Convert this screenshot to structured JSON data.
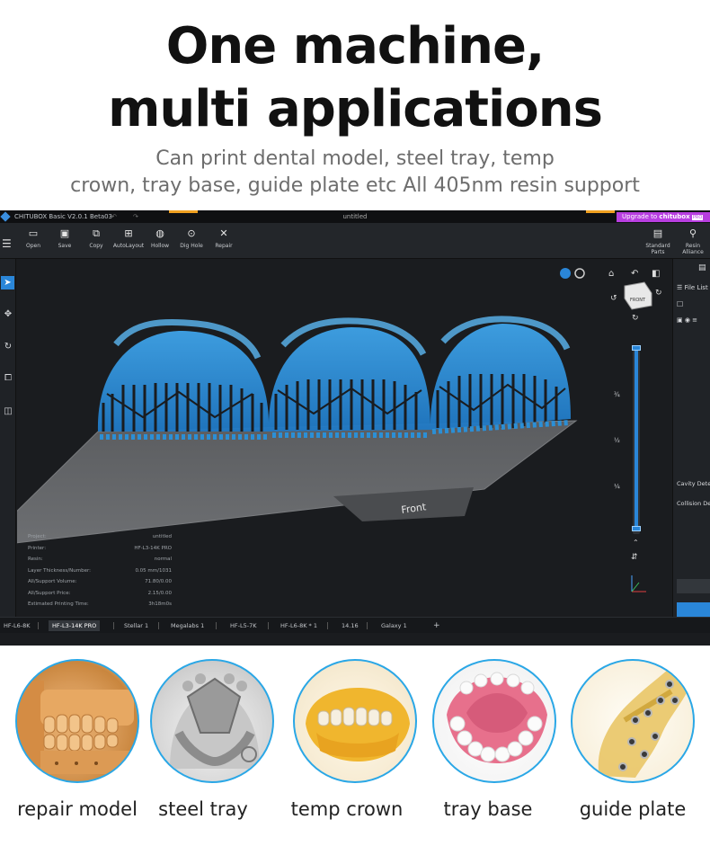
{
  "headline": {
    "line1": "One machine,",
    "line2": "multi applications"
  },
  "subheadline": {
    "line1": "Can print dental model, steel tray, temp",
    "line2": "crown, tray base, guide plate etc All 405nm resin support"
  },
  "app": {
    "title": "CHITUBOX Basic V2.0.1 Beta03",
    "document": "untitled",
    "upgrade_label": "Upgrade to",
    "upgrade_brand": "chitubox",
    "upgrade_tier": "PRO",
    "toolbar": [
      {
        "label": "Open",
        "icon": "folder-icon"
      },
      {
        "label": "Save",
        "icon": "save-icon"
      },
      {
        "label": "Copy",
        "icon": "copy-icon"
      },
      {
        "label": "AutoLayout",
        "icon": "autolayout-icon"
      },
      {
        "label": "Hollow",
        "icon": "hollow-icon"
      },
      {
        "label": "Dig Hole",
        "icon": "dig-hole-icon"
      },
      {
        "label": "Repair",
        "icon": "repair-icon"
      }
    ],
    "toolbar_right": [
      {
        "label": "Standard Parts",
        "icon": "standard-parts-icon"
      },
      {
        "label": "Resin Alliance",
        "icon": "resin-alliance-icon"
      }
    ],
    "right_panel": {
      "file_list": "File List",
      "cavity": "Cavity Detec",
      "collision": "Collision De"
    },
    "view_cube_label": "FRONT",
    "plate_label": "Front",
    "slider_fractions": [
      "¾",
      "½",
      "¼"
    ],
    "info": [
      {
        "key": "Project:",
        "value": "untitled"
      },
      {
        "key": "Printer:",
        "value": "HF-L3-14K PRO"
      },
      {
        "key": "Resin:",
        "value": "normal"
      },
      {
        "key": "Layer Thickness/Number:",
        "value": "0.05 mm/1031"
      },
      {
        "key": "All/Support Volume:",
        "value": "71.80/0.00"
      },
      {
        "key": "All/Support Price:",
        "value": "2.15/0.00"
      },
      {
        "key": "Estimated Printing Time:",
        "value": "3h18m0s"
      }
    ],
    "tabs": [
      "HF-L6-8K",
      "HF-L3-14K PRO",
      "Stellar 1",
      "Megalabs 1",
      "HF-L5-7K",
      "HF-L6-8K * 1",
      "14.16",
      "Galaxy 1"
    ],
    "active_tab": 1,
    "add_tab": "+"
  },
  "applications": [
    {
      "caption": "repair model"
    },
    {
      "caption": "steel tray"
    },
    {
      "caption": "temp crown"
    },
    {
      "caption": "tray base"
    },
    {
      "caption": "guide plate"
    }
  ],
  "colors": {
    "accent": "#2a86d8",
    "model": "#2b8fd6",
    "circle_border": "#2aa7e6",
    "upgrade": "#b83ee0"
  }
}
